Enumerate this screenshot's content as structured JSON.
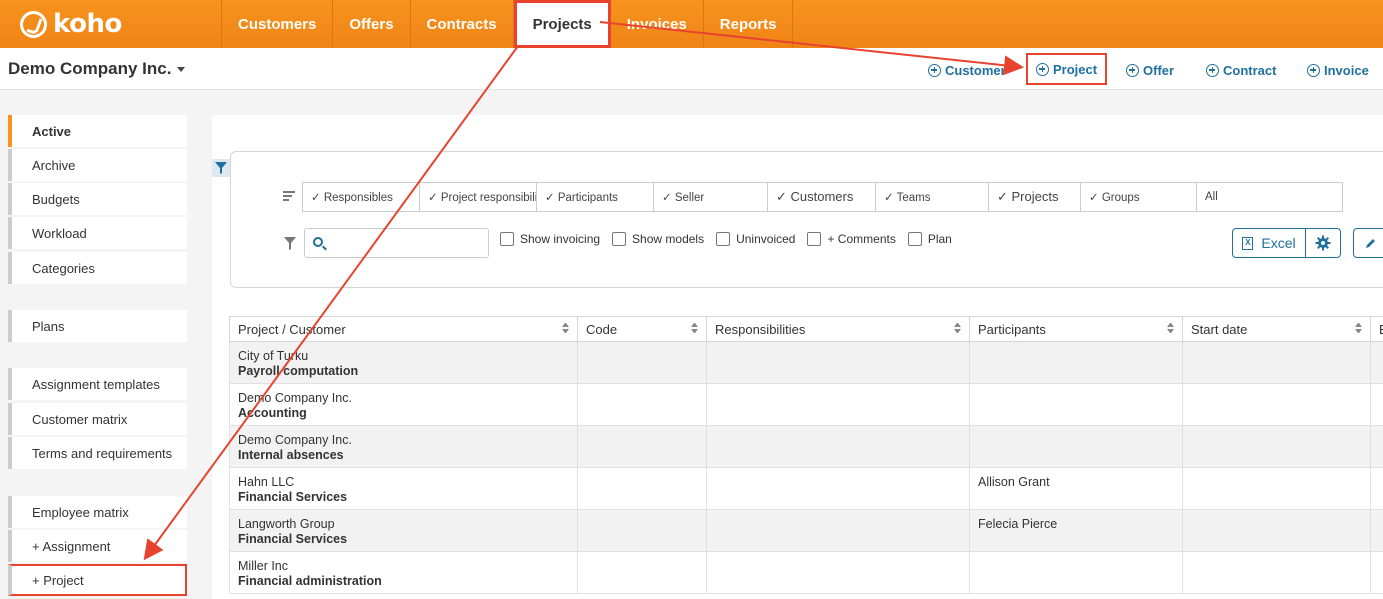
{
  "brand": {
    "logo_text": "koho",
    "accent": "#f7931e",
    "link_color": "#20709e",
    "highlight": "#e8432f"
  },
  "nav": {
    "items": [
      {
        "label": "Customers"
      },
      {
        "label": "Offers"
      },
      {
        "label": "Contracts"
      },
      {
        "label": "Projects",
        "active": true
      },
      {
        "label": "Invoices"
      },
      {
        "label": "Reports"
      }
    ]
  },
  "subheader": {
    "company": "Demo Company Inc.",
    "quick_links": [
      "Customer",
      "Project",
      "Offer",
      "Contract",
      "Invoice"
    ]
  },
  "sidebar": {
    "items": [
      "Active",
      "Archive",
      "Budgets",
      "Workload",
      "Categories",
      "Plans",
      "Assignment templates",
      "Customer matrix",
      "Terms and requirements",
      "Employee matrix",
      "+ Assignment",
      "+ Project"
    ]
  },
  "filters": {
    "chips": [
      "✓ Responsibles",
      "✓ Project responsibilities",
      "✓ Participants",
      "✓ Seller",
      "✓ Customers",
      "✓ Teams",
      "✓ Projects",
      "✓ Groups",
      "All"
    ],
    "search_placeholder": "",
    "checkboxes": [
      "Show invoicing",
      "Show models",
      "Uninvoiced",
      "+ Comments",
      "Plan"
    ],
    "excel_label": "Excel"
  },
  "table": {
    "columns": [
      "Project / Customer",
      "Code",
      "Responsibilities",
      "Participants",
      "Start date",
      "E"
    ],
    "rows": [
      {
        "customer": "City of Turku",
        "project": "Payroll computation",
        "code": "",
        "responsibilities": "",
        "participants": ""
      },
      {
        "customer": "Demo Company Inc.",
        "project": "Accounting",
        "code": "",
        "responsibilities": "",
        "participants": ""
      },
      {
        "customer": "Demo Company Inc.",
        "project": "Internal absences",
        "code": "",
        "responsibilities": "",
        "participants": ""
      },
      {
        "customer": "Hahn LLC",
        "project": "Financial Services",
        "code": "",
        "responsibilities": "",
        "participants": "Allison Grant"
      },
      {
        "customer": "Langworth Group",
        "project": "Financial Services",
        "code": "",
        "responsibilities": "",
        "participants": "Felecia Pierce"
      },
      {
        "customer": "Miller Inc",
        "project": "Financial administration",
        "code": "",
        "responsibilities": "",
        "participants": ""
      }
    ]
  }
}
